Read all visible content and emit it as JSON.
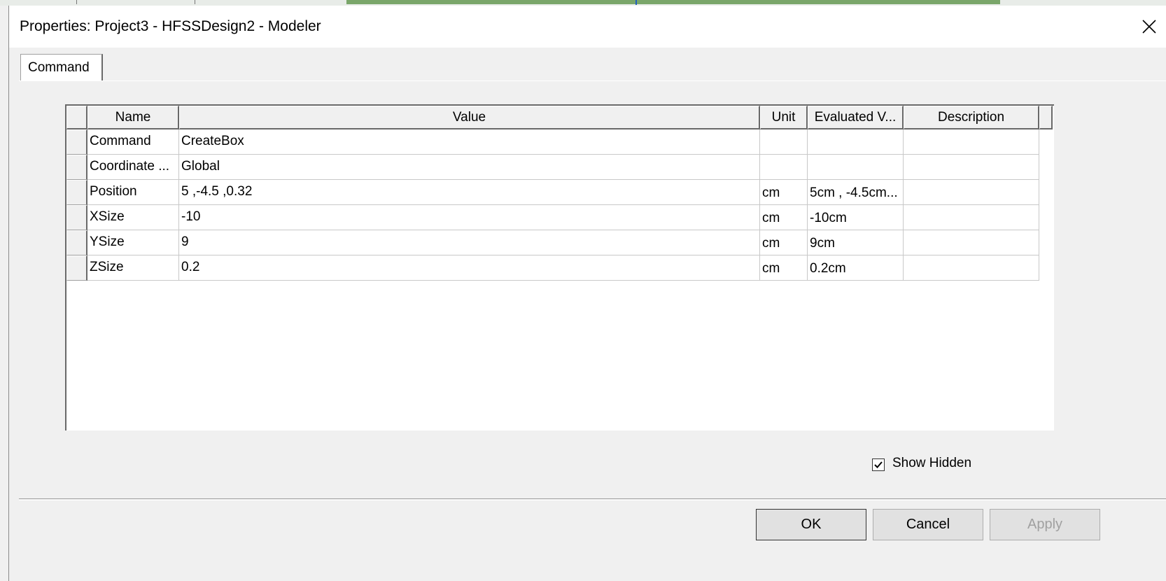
{
  "window": {
    "title": "Properties: Project3 - HFSSDesign2 - Modeler"
  },
  "tabs": [
    {
      "label": "Command"
    }
  ],
  "grid": {
    "columns": [
      "Name",
      "Value",
      "Unit",
      "Evaluated V...",
      "Description"
    ],
    "rows": [
      {
        "name": "Command",
        "value": "CreateBox",
        "unit": "",
        "evaluated": "",
        "description": ""
      },
      {
        "name": "Coordinate ...",
        "value": "Global",
        "unit": "",
        "evaluated": "",
        "description": ""
      },
      {
        "name": "Position",
        "value": "5 ,-4.5 ,0.32",
        "unit": "cm",
        "evaluated": "5cm , -4.5cm...",
        "description": ""
      },
      {
        "name": "XSize",
        "value": "-10",
        "unit": "cm",
        "evaluated": "-10cm",
        "description": ""
      },
      {
        "name": "YSize",
        "value": "9",
        "unit": "cm",
        "evaluated": "9cm",
        "description": ""
      },
      {
        "name": "ZSize",
        "value": "0.2",
        "unit": "cm",
        "evaluated": "0.2cm",
        "description": ""
      }
    ]
  },
  "show_hidden": {
    "label": "Show Hidden",
    "checked": true
  },
  "buttons": {
    "ok": "OK",
    "cancel": "Cancel",
    "apply": "Apply"
  },
  "icons": {
    "close": "close-icon",
    "check": "checkmark-icon"
  }
}
